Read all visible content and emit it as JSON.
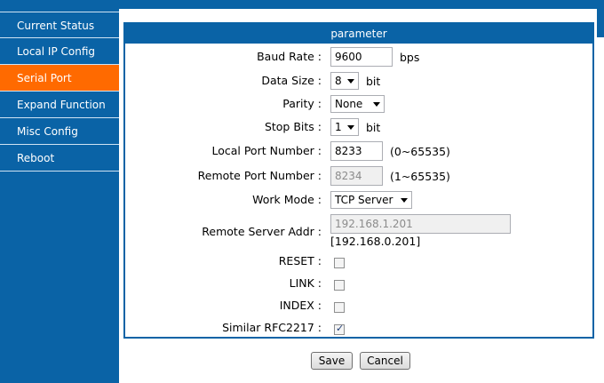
{
  "sidebar": {
    "items": [
      {
        "label": "Current Status",
        "active": false
      },
      {
        "label": "Local IP Config",
        "active": false
      },
      {
        "label": "Serial Port",
        "active": true
      },
      {
        "label": "Expand Function",
        "active": false
      },
      {
        "label": "Misc Config",
        "active": false
      },
      {
        "label": "Reboot",
        "active": false
      }
    ]
  },
  "panel": {
    "title": "parameter",
    "baud_rate": {
      "label": "Baud Rate :",
      "value": "9600",
      "unit": "bps"
    },
    "data_size": {
      "label": "Data Size :",
      "value": "8",
      "unit": "bit"
    },
    "parity": {
      "label": "Parity :",
      "value": "None"
    },
    "stop_bits": {
      "label": "Stop Bits :",
      "value": "1",
      "unit": "bit"
    },
    "local_port": {
      "label": "Local Port Number :",
      "value": "8233",
      "range": "(0~65535)"
    },
    "remote_port": {
      "label": "Remote Port Number :",
      "value": "8234",
      "range": "(1~65535)"
    },
    "work_mode": {
      "label": "Work Mode :",
      "value": "TCP Server"
    },
    "remote_addr": {
      "label": "Remote Server Addr :",
      "value": "192.168.1.201",
      "note": "[192.168.0.201]"
    },
    "reset": {
      "label": "RESET :",
      "checked": false
    },
    "link": {
      "label": "LINK :",
      "checked": false
    },
    "index": {
      "label": "INDEX :",
      "checked": false
    },
    "rfc2217": {
      "label": "Similar RFC2217 :",
      "checked": true
    }
  },
  "buttons": {
    "save": "Save",
    "cancel": "Cancel"
  },
  "colors": {
    "brand": "#0a63a6",
    "active": "#ff6a00"
  }
}
